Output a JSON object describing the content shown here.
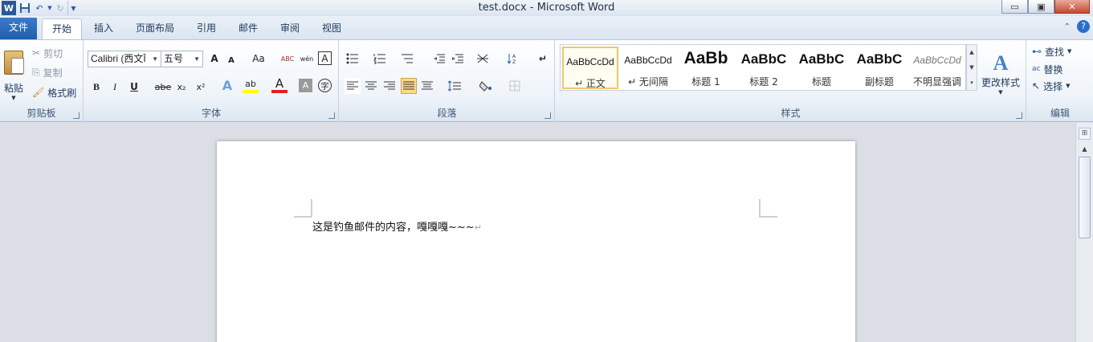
{
  "window": {
    "title": "test.docx - Microsoft Word",
    "app_letter": "W",
    "controls": {
      "minimize": "▭",
      "restore": "▣",
      "close": "✕"
    }
  },
  "tabs": [
    {
      "label": "文件"
    },
    {
      "label": "开始"
    },
    {
      "label": "插入"
    },
    {
      "label": "页面布局"
    },
    {
      "label": "引用"
    },
    {
      "label": "邮件"
    },
    {
      "label": "审阅"
    },
    {
      "label": "视图"
    }
  ],
  "ribbon": {
    "clipboard": {
      "label": "剪贴板",
      "paste": "粘贴",
      "cut": "剪切",
      "copy": "复制",
      "format_painter": "格式刷"
    },
    "font": {
      "label": "字体",
      "font_name": "Calibri (西文Ī",
      "font_size": "五号",
      "grow": "A",
      "shrink": "A",
      "change_case": "Aa",
      "clear_format": "ABC",
      "phonetic": "wén",
      "char_border": "A",
      "bold": "B",
      "italic": "I",
      "underline": "U",
      "strike": "abe",
      "subscript": "x₂",
      "superscript": "x²",
      "text_effect": "A",
      "highlight": "ab",
      "font_color": "A",
      "char_shading": "A",
      "enclose": "字"
    },
    "paragraph": {
      "label": "段落"
    },
    "styles": {
      "label": "样式",
      "items": [
        {
          "preview": "AaBbCcDd",
          "name": "↵ 正文"
        },
        {
          "preview": "AaBbCcDd",
          "name": "↵ 无间隔"
        },
        {
          "preview": "AaBb",
          "name": "标题 1"
        },
        {
          "preview": "AaBbC",
          "name": "标题 2"
        },
        {
          "preview": "AaBbC",
          "name": "标题"
        },
        {
          "preview": "AaBbC",
          "name": "副标题"
        },
        {
          "preview": "AaBbCcDd",
          "name": "不明显强调"
        }
      ],
      "change_styles": "更改样式"
    },
    "editing": {
      "label": "编辑",
      "find": "查找",
      "replace": "替换",
      "select": "选择"
    }
  },
  "document": {
    "body_text": "这是钓鱼邮件的内容，嘎嘎嘎~~~",
    "para_mark": "↵"
  },
  "colors": {
    "file_tab": "#2b6cbf",
    "highlight": "#ffff00",
    "font_color": "#e02020"
  }
}
